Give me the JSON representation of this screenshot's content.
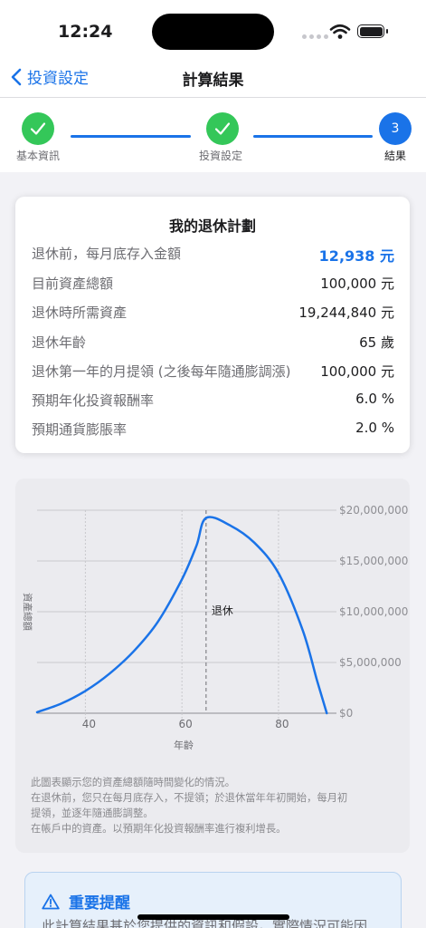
{
  "status": {
    "time": "12:24"
  },
  "nav": {
    "back_label": "投資設定",
    "title": "計算結果"
  },
  "stepper": {
    "steps": [
      {
        "label": "基本資訊",
        "state": "done"
      },
      {
        "label": "投資設定",
        "state": "done"
      },
      {
        "label": "結果",
        "number": "3",
        "state": "current"
      }
    ]
  },
  "summary": {
    "title": "我的退休計劃",
    "rows": [
      {
        "label": "退休前，每月底存入金額",
        "value": "12,938 元"
      },
      {
        "label": "目前資產總額",
        "value": "100,000 元"
      },
      {
        "label": "退休時所需資產",
        "value": "19,244,840 元"
      },
      {
        "label": "退休年齡",
        "value": "65 歲"
      },
      {
        "label": "退休第一年的月提領 (之後每年隨通膨調漲)",
        "value": "100,000 元"
      },
      {
        "label": "預期年化投資報酬率",
        "value": "6.0 %"
      },
      {
        "label": "預期通貨膨脹率",
        "value": "2.0 %"
      }
    ]
  },
  "chart_data": {
    "type": "line",
    "xlabel": "年齡",
    "ylabel": "資產總額",
    "x_ticks": [
      "40",
      "60",
      "80"
    ],
    "y_ticks": [
      "$0",
      "$5,000,000",
      "$10,000,000",
      "$15,000,000",
      "$20,000,000"
    ],
    "xlim": [
      30,
      92
    ],
    "ylim": [
      0,
      20000000
    ],
    "annotation": {
      "x": 65,
      "label": "退休"
    },
    "series": [
      {
        "x": [
          30,
          35,
          40,
          45,
          50,
          55,
          60,
          63,
          65,
          70,
          75,
          80,
          85,
          88,
          90
        ],
        "values": [
          100000,
          950000,
          2200000,
          3900000,
          6100000,
          9000000,
          13200000,
          16500000,
          19244840,
          18500000,
          16800000,
          13800000,
          8200000,
          3200000,
          0
        ]
      }
    ],
    "colors": {
      "line": "#1a73e8",
      "grid": "#c8c8cc"
    }
  },
  "chart_note": {
    "lines": [
      "此圖表顯示您的資產總額隨時間變化的情況。",
      "在退休前，您只在每月底存入，不提領；於退休當年年初開始，每月初",
      "提領，並逐年隨通膨調整。",
      "在帳戶中的資產。以預期年化投資報酬率進行複利增長。"
    ]
  },
  "alert": {
    "title": "重要提醒",
    "text": "此計算結果基於您提供的資訊和假設。實際情況可能因"
  },
  "colors": {
    "accent": "#1a73e8",
    "success": "#34c759"
  }
}
